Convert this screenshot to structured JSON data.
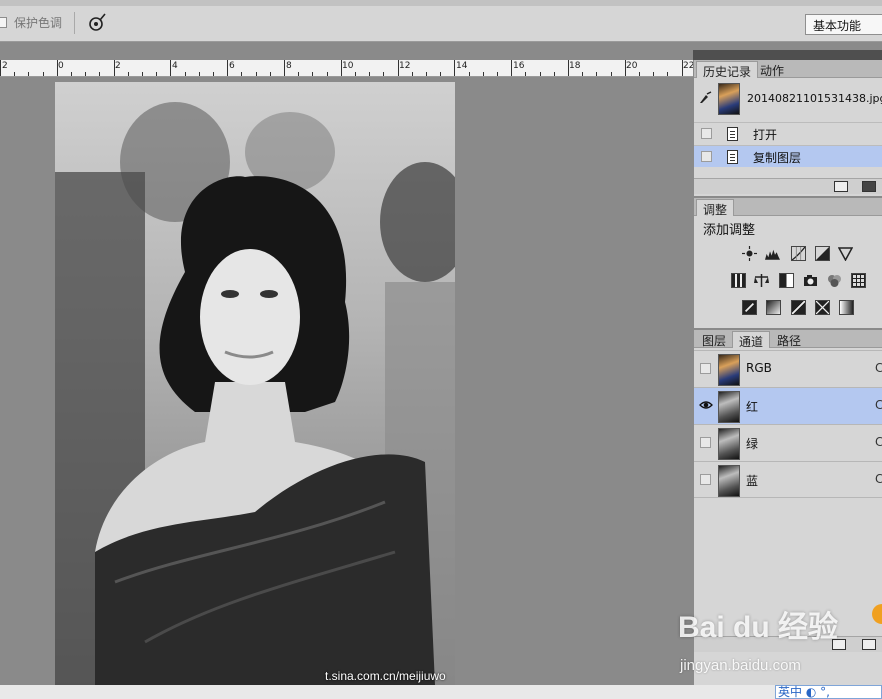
{
  "options_bar": {
    "protect_tone_label": "保护色调",
    "workspace_label": "基本功能"
  },
  "ruler": {
    "labels": [
      "2",
      "0",
      "2",
      "4",
      "6",
      "8",
      "10",
      "12",
      "14",
      "16",
      "18",
      "20",
      "22"
    ]
  },
  "canvas": {
    "watermark": "t.sina.com.cn/meijiuwo"
  },
  "history_panel": {
    "tabs": [
      "历史记录",
      "动作"
    ],
    "snapshot_name": "20140821101531438.jpg",
    "items": [
      {
        "label": "打开",
        "selected": false
      },
      {
        "label": "复制图层",
        "selected": true
      }
    ]
  },
  "adjustments_panel": {
    "tab": "调整",
    "title": "添加调整"
  },
  "channels_panel": {
    "tabs": [
      "图层",
      "通道",
      "路径"
    ],
    "channels": [
      {
        "name": "RGB",
        "visible": false,
        "selected": false,
        "shortcut": "C"
      },
      {
        "name": "红",
        "visible": true,
        "selected": true,
        "shortcut": "C"
      },
      {
        "name": "绿",
        "visible": false,
        "selected": false,
        "shortcut": "C"
      },
      {
        "name": "蓝",
        "visible": false,
        "selected": false,
        "shortcut": "C"
      }
    ]
  },
  "overlay": {
    "baidu_logo": "Bai du 经验",
    "baidu_url": "jingyan.baidu.com",
    "ime_text": "英中 ◐ °,"
  },
  "colors": {
    "selection": "#b4c8f0",
    "panel_bg": "#d6d6d6",
    "canvas_bg": "#8a8a8a"
  }
}
